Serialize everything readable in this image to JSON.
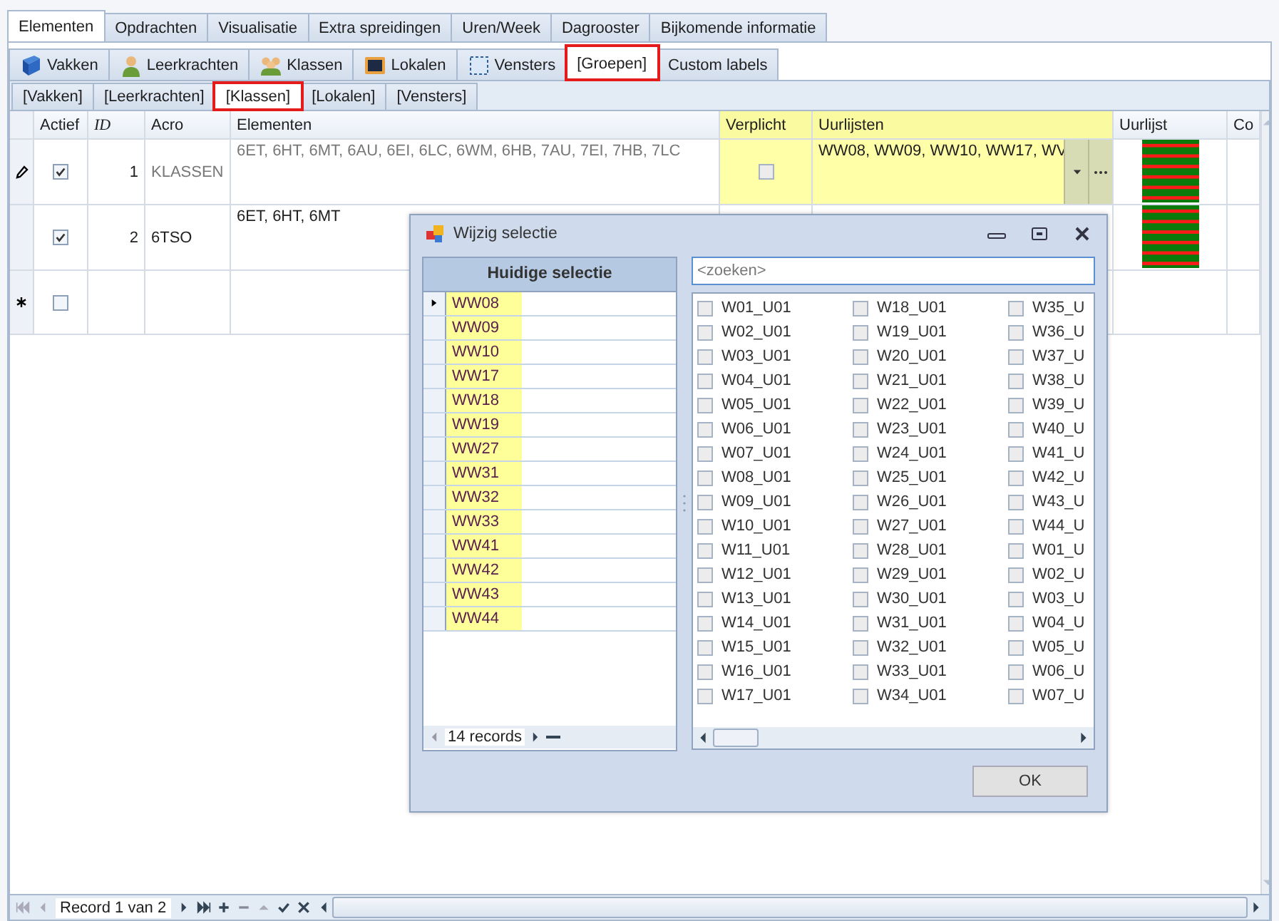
{
  "main_tabs": [
    {
      "label": "Elementen",
      "selected": true
    },
    {
      "label": "Opdrachten",
      "selected": false
    },
    {
      "label": "Visualisatie",
      "selected": false
    },
    {
      "label": "Extra spreidingen",
      "selected": false
    },
    {
      "label": "Uren/Week",
      "selected": false
    },
    {
      "label": "Dagrooster",
      "selected": false
    },
    {
      "label": "Bijkomende informatie",
      "selected": false
    }
  ],
  "element_tabs": [
    {
      "label": "Vakken",
      "selected": false,
      "highlighted": false
    },
    {
      "label": "Leerkrachten",
      "selected": false,
      "highlighted": false
    },
    {
      "label": "Klassen",
      "selected": false,
      "highlighted": false
    },
    {
      "label": "Lokalen",
      "selected": false,
      "highlighted": false
    },
    {
      "label": "Vensters",
      "selected": false,
      "highlighted": false
    },
    {
      "label": "[Groepen]",
      "selected": true,
      "highlighted": true
    },
    {
      "label": "Custom labels",
      "selected": false,
      "highlighted": false
    }
  ],
  "group_tabs": [
    {
      "label": "[Vakken]",
      "selected": false,
      "highlighted": false
    },
    {
      "label": "[Leerkrachten]",
      "selected": false,
      "highlighted": false
    },
    {
      "label": "[Klassen]",
      "selected": true,
      "highlighted": true
    },
    {
      "label": "[Lokalen]",
      "selected": false,
      "highlighted": false
    },
    {
      "label": "[Vensters]",
      "selected": false,
      "highlighted": false
    }
  ],
  "table": {
    "columns": [
      "Actief",
      "ID",
      "Acro",
      "Elementen",
      "Verplicht",
      "Uurlijsten",
      "Uurlijst",
      "Co"
    ],
    "rows": [
      {
        "kind": "record",
        "selected": true,
        "actief": true,
        "id": "1",
        "acro": "KLASSEN",
        "elementen": "6ET, 6HT, 6MT, 6AU, 6EI, 6LC, 6WM, 6HB, 7AU, 7EI, 7HB, 7LC",
        "verplicht": false,
        "uurlijsten": "WW08, WW09, WW10, WW17, WV"
      },
      {
        "kind": "record",
        "selected": false,
        "actief": true,
        "id": "2",
        "acro": "6TSO",
        "elementen": "6ET, 6HT, 6MT"
      },
      {
        "kind": "new",
        "selected": false,
        "actief": false
      }
    ]
  },
  "navigator": {
    "text": "Record 1 van 2"
  },
  "dialog": {
    "title": "Wijzig selectie",
    "current": {
      "header": "Huidige selectie",
      "items": [
        "WW08",
        "WW09",
        "WW10",
        "WW17",
        "WW18",
        "WW19",
        "WW27",
        "WW31",
        "WW32",
        "WW33",
        "WW41",
        "WW42",
        "WW43",
        "WW44"
      ],
      "count": "14 records"
    },
    "search": {
      "placeholder": "<zoeken>"
    },
    "options": [
      [
        {
          "label": "W01_U01",
          "checked": false
        },
        {
          "label": "W02_U01",
          "checked": false
        },
        {
          "label": "W03_U01",
          "checked": false
        },
        {
          "label": "W04_U01",
          "checked": false
        },
        {
          "label": "W05_U01",
          "checked": false
        },
        {
          "label": "W06_U01",
          "checked": false
        },
        {
          "label": "W07_U01",
          "checked": false
        },
        {
          "label": "W08_U01",
          "checked": false
        },
        {
          "label": "W09_U01",
          "checked": false
        },
        {
          "label": "W10_U01",
          "checked": false
        },
        {
          "label": "W11_U01",
          "checked": false
        },
        {
          "label": "W12_U01",
          "checked": false
        },
        {
          "label": "W13_U01",
          "checked": false
        },
        {
          "label": "W14_U01",
          "checked": false
        },
        {
          "label": "W15_U01",
          "checked": false
        },
        {
          "label": "W16_U01",
          "checked": false
        },
        {
          "label": "W17_U01",
          "checked": false
        }
      ],
      [
        {
          "label": "W18_U01",
          "checked": false
        },
        {
          "label": "W19_U01",
          "checked": false
        },
        {
          "label": "W20_U01",
          "checked": false
        },
        {
          "label": "W21_U01",
          "checked": false
        },
        {
          "label": "W22_U01",
          "checked": false
        },
        {
          "label": "W23_U01",
          "checked": false
        },
        {
          "label": "W24_U01",
          "checked": false
        },
        {
          "label": "W25_U01",
          "checked": false
        },
        {
          "label": "W26_U01",
          "checked": false
        },
        {
          "label": "W27_U01",
          "checked": false
        },
        {
          "label": "W28_U01",
          "checked": false
        },
        {
          "label": "W29_U01",
          "checked": false
        },
        {
          "label": "W30_U01",
          "checked": false
        },
        {
          "label": "W31_U01",
          "checked": false
        },
        {
          "label": "W32_U01",
          "checked": false
        },
        {
          "label": "W33_U01",
          "checked": false
        },
        {
          "label": "W34_U01",
          "checked": false
        }
      ],
      [
        {
          "label": "W35_U",
          "checked": false
        },
        {
          "label": "W36_U",
          "checked": false
        },
        {
          "label": "W37_U",
          "checked": false
        },
        {
          "label": "W38_U",
          "checked": false
        },
        {
          "label": "W39_U",
          "checked": false
        },
        {
          "label": "W40_U",
          "checked": false
        },
        {
          "label": "W41_U",
          "checked": false
        },
        {
          "label": "W42_U",
          "checked": false
        },
        {
          "label": "W43_U",
          "checked": false
        },
        {
          "label": "W44_U",
          "checked": false
        },
        {
          "label": "W01_U",
          "checked": false
        },
        {
          "label": "W02_U",
          "checked": false
        },
        {
          "label": "W03_U",
          "checked": false
        },
        {
          "label": "W04_U",
          "checked": false
        },
        {
          "label": "W05_U",
          "checked": false
        },
        {
          "label": "W06_U",
          "checked": false
        },
        {
          "label": "W07_U",
          "checked": false
        }
      ]
    ],
    "ok_button": "OK"
  }
}
